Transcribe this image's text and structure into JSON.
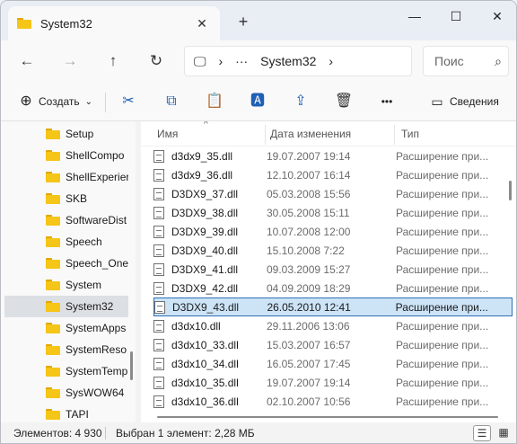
{
  "tab": {
    "title": "System32",
    "close": "✕",
    "new": "+"
  },
  "window": {
    "minimize": "—",
    "maximize": "☐",
    "close": "✕"
  },
  "nav": {
    "back": "←",
    "forward": "→",
    "up": "↑",
    "refresh": "↻"
  },
  "address": {
    "monitor": "🖵",
    "chevron1": "›",
    "ellipsis": "···",
    "folder": "System32",
    "chevron2": "›"
  },
  "search": {
    "placeholder": "Поис",
    "icon": "⌕"
  },
  "toolbar": {
    "create_label": "Создать",
    "create_icon": "⊕",
    "create_dropdown": "⌄",
    "cut_icon": "✂",
    "copy_icon": "⧉",
    "paste_icon": "📋",
    "rename_icon": "🅰",
    "share_icon": "⇪",
    "delete_icon": "🗑",
    "more_icon": "•••",
    "details_icon": "▭",
    "details_label": "Сведения"
  },
  "sidebar": {
    "items": [
      {
        "label": "Setup"
      },
      {
        "label": "ShellCompo"
      },
      {
        "label": "ShellExperier"
      },
      {
        "label": "SKB"
      },
      {
        "label": "SoftwareDist"
      },
      {
        "label": "Speech"
      },
      {
        "label": "Speech_One"
      },
      {
        "label": "System"
      },
      {
        "label": "System32",
        "selected": true
      },
      {
        "label": "SystemApps"
      },
      {
        "label": "SystemReso"
      },
      {
        "label": "SystemTemp"
      },
      {
        "label": "SysWOW64"
      },
      {
        "label": "TAPI"
      }
    ]
  },
  "columns": {
    "name": "Имя",
    "date": "Дата изменения",
    "type": "Тип",
    "sort_icon": "^"
  },
  "files": [
    {
      "name": "d3dx9_35.dll",
      "date": "19.07.2007 19:14",
      "type": "Расширение при..."
    },
    {
      "name": "d3dx9_36.dll",
      "date": "12.10.2007 16:14",
      "type": "Расширение при..."
    },
    {
      "name": "D3DX9_37.dll",
      "date": "05.03.2008 15:56",
      "type": "Расширение при..."
    },
    {
      "name": "D3DX9_38.dll",
      "date": "30.05.2008 15:11",
      "type": "Расширение при..."
    },
    {
      "name": "D3DX9_39.dll",
      "date": "10.07.2008 12:00",
      "type": "Расширение при..."
    },
    {
      "name": "D3DX9_40.dll",
      "date": "15.10.2008 7:22",
      "type": "Расширение при..."
    },
    {
      "name": "D3DX9_41.dll",
      "date": "09.03.2009 15:27",
      "type": "Расширение при..."
    },
    {
      "name": "D3DX9_42.dll",
      "date": "04.09.2009 18:29",
      "type": "Расширение при..."
    },
    {
      "name": "D3DX9_43.dll",
      "date": "26.05.2010 12:41",
      "type": "Расширение при...",
      "selected": true
    },
    {
      "name": "d3dx10.dll",
      "date": "29.11.2006 13:06",
      "type": "Расширение при..."
    },
    {
      "name": "d3dx10_33.dll",
      "date": "15.03.2007 16:57",
      "type": "Расширение при..."
    },
    {
      "name": "d3dx10_34.dll",
      "date": "16.05.2007 17:45",
      "type": "Расширение при..."
    },
    {
      "name": "d3dx10_35.dll",
      "date": "19.07.2007 19:14",
      "type": "Расширение при..."
    },
    {
      "name": "d3dx10_36.dll",
      "date": "02.10.2007 10:56",
      "type": "Расширение при..."
    }
  ],
  "status": {
    "count": "Элементов: 4 930",
    "selection": "Выбран 1 элемент: 2,28 МБ",
    "details_view": "☰",
    "tiles_view": "▦"
  },
  "colors": {
    "accent": "#2f6fb6",
    "selection": "#cde4f7",
    "folder": "#f5c518"
  }
}
